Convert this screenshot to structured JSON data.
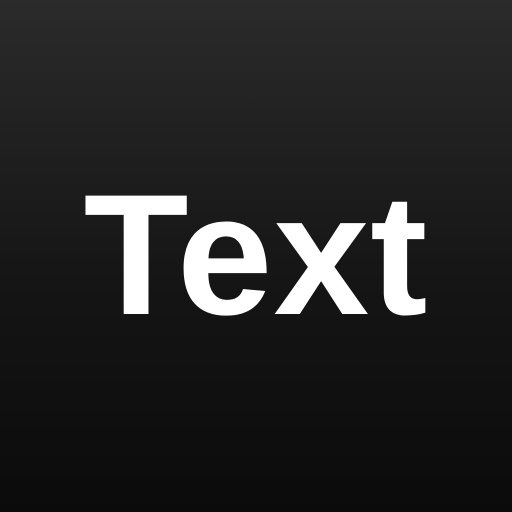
{
  "icon": {
    "label": "Text",
    "text_color": "#ffffff",
    "background_top": "#2b2b2b",
    "background_bottom": "#0b0b0b"
  }
}
